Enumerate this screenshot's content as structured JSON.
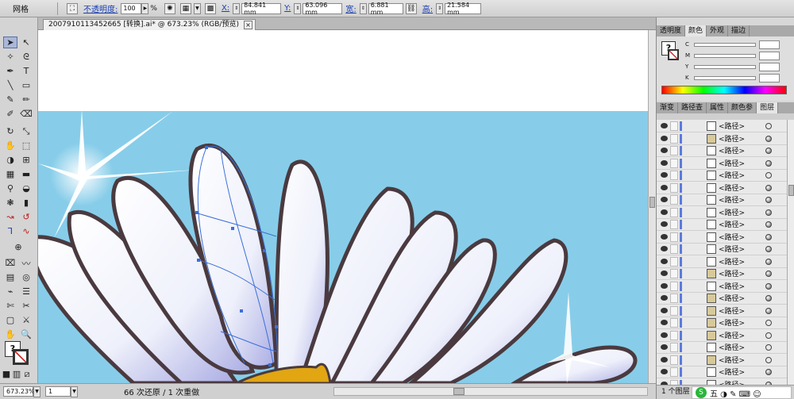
{
  "control_bar": {
    "mode_label": "网格",
    "opacity_label": "不透明度:",
    "opacity_value": "100",
    "percent": "%",
    "x_label": "X:",
    "x_value": "84.841 mm",
    "y_label": "Y:",
    "y_value": "63.096 mm",
    "w_label": "宽:",
    "w_value": "6.881 mm",
    "h_label": "高:",
    "h_value": "21.584 mm"
  },
  "document": {
    "tab_title": "2007910113452665 [转换].ai* @ 673.23% (RGB/预览)",
    "close": "×"
  },
  "status_bar": {
    "zoom": "673.23%",
    "page": "1",
    "history": "66 次还原 / 1 次重做"
  },
  "panels": {
    "top_tabs": [
      "透明度",
      "颜色",
      "外观",
      "描边"
    ],
    "top_active": 1,
    "cmyk_labels": [
      "C",
      "M",
      "Y",
      "K"
    ],
    "mid_tabs": [
      "渐变",
      "路径查",
      "属性",
      "颜色参",
      "图层"
    ],
    "mid_active": 4,
    "layer_name": "<路径>",
    "footer": "1 个图层"
  },
  "ime": {
    "logo": "S",
    "text": "五 ◑ ✎ ⌨ ☺"
  },
  "colors": {
    "sky": "#87cde9",
    "petal_outline": "#4a3a3f",
    "petal_fill": "#ffffff",
    "petal_shade": "#bcbde8",
    "center": "#e1a612",
    "path_blue": "#3a6fd9"
  }
}
